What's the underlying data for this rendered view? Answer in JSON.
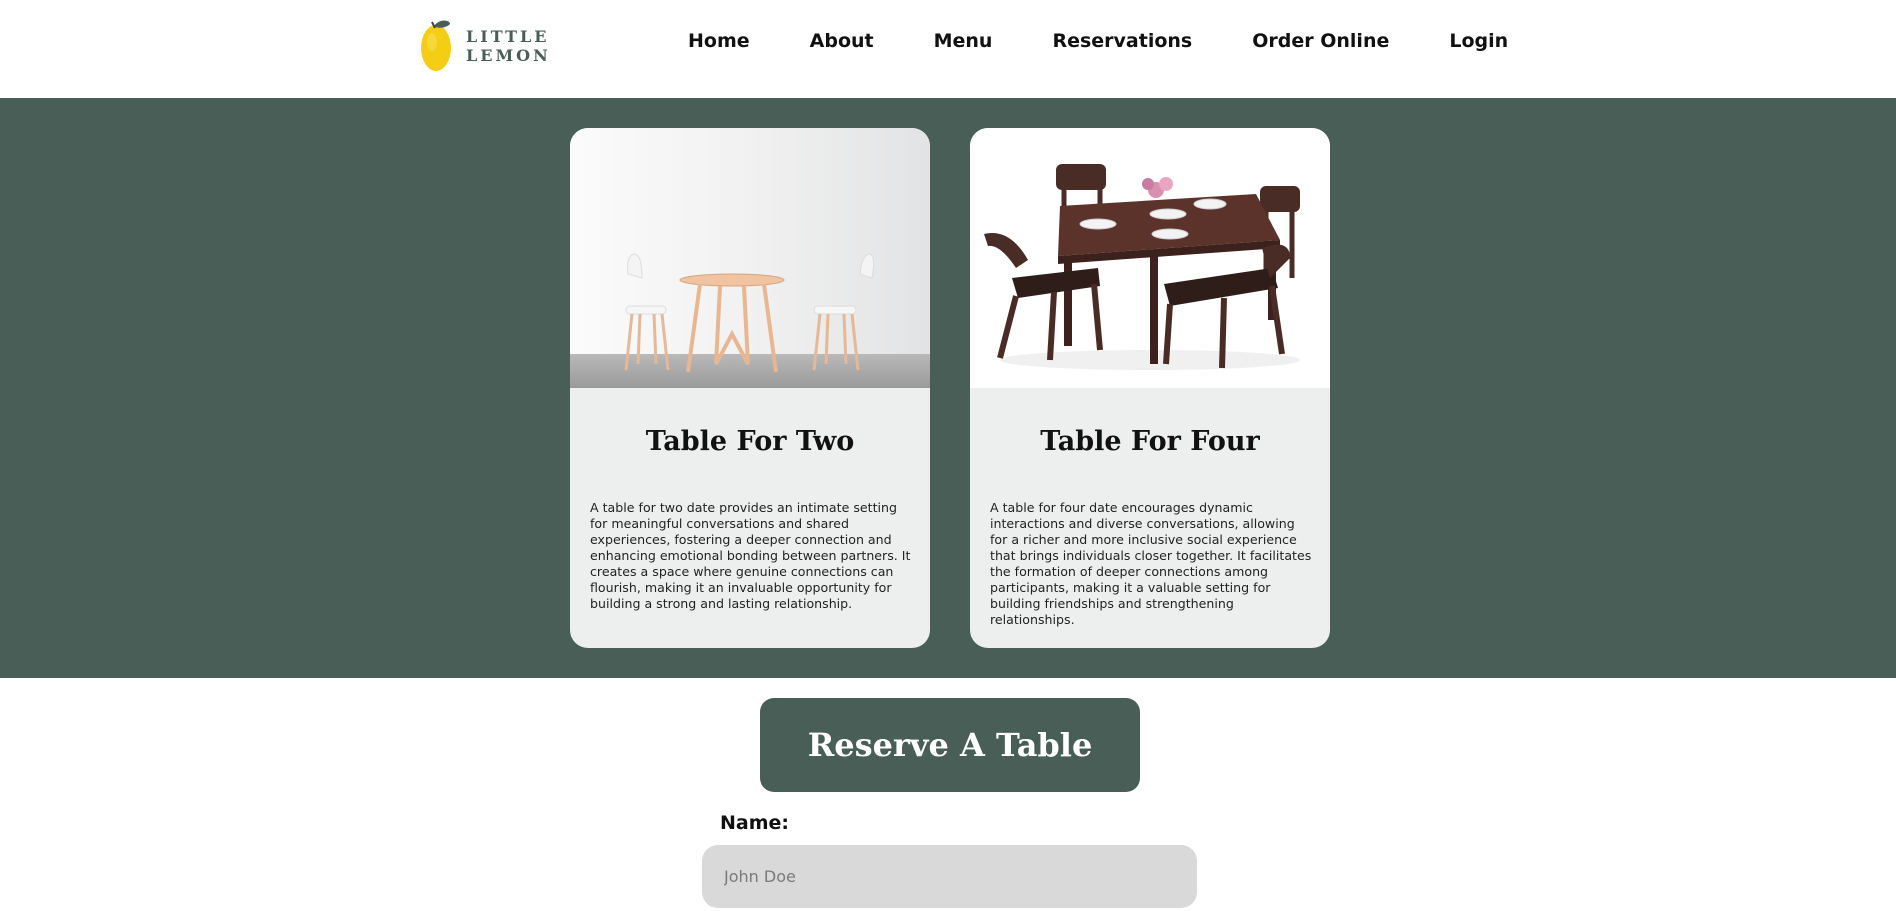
{
  "header": {
    "logo_text": "LITTLE LEMON",
    "nav": [
      {
        "label": "Home"
      },
      {
        "label": "About"
      },
      {
        "label": "Menu"
      },
      {
        "label": "Reservations"
      },
      {
        "label": "Order Online"
      },
      {
        "label": "Login"
      }
    ]
  },
  "cards": [
    {
      "title": "Table For Two",
      "description": "A table for two date provides an intimate setting for meaningful conversations and shared experiences, fostering a deeper connection and enhancing emotional bonding between partners. It creates a space where genuine connections can flourish, making it an invaluable opportunity for building a strong and lasting relationship."
    },
    {
      "title": "Table For Four",
      "description": "A table for four date encourages dynamic interactions and diverse conversations, allowing for a richer and more inclusive social experience that brings individuals closer together. It facilitates the formation of deeper connections among participants, making it a valuable setting for building friendships and strengthening relationships."
    }
  ],
  "reserve": {
    "button_label": "Reserve A Table",
    "name_label": "Name:",
    "name_placeholder": "John Doe",
    "name_value": ""
  },
  "colors": {
    "primary": "#495e57",
    "card_bg": "#edefee",
    "input_bg": "#d9d9d9",
    "lemon": "#f4ce14"
  }
}
